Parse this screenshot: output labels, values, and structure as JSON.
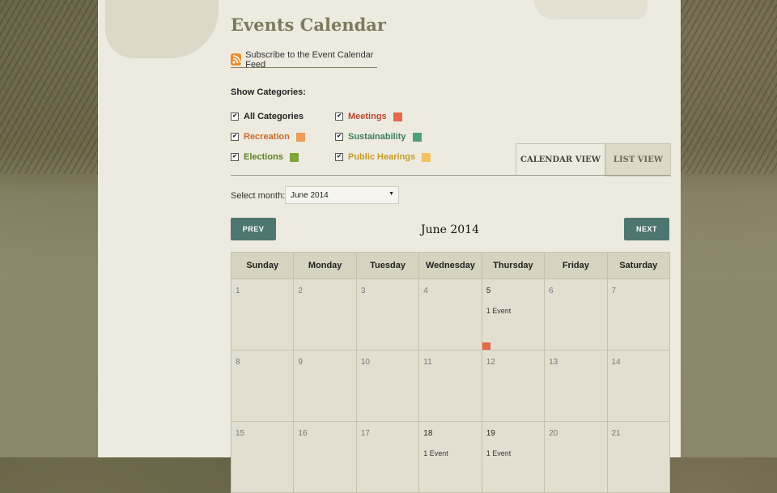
{
  "page": {
    "title": "Events Calendar"
  },
  "feed": {
    "label": "Subscribe to the Event Calendar Feed",
    "icon": "rss-icon"
  },
  "categories": {
    "heading": "Show Categories:",
    "items": [
      {
        "label": "All Categories",
        "color": "",
        "text_color": "#222222",
        "checked": true
      },
      {
        "label": "Meetings",
        "color": "#e5684b",
        "text_color": "#b9482f",
        "checked": true
      },
      {
        "label": "Recreation",
        "color": "#ef9a56",
        "text_color": "#c96a2b",
        "checked": true
      },
      {
        "label": "Sustainability",
        "color": "#4fa07c",
        "text_color": "#3b7d5c",
        "checked": true
      },
      {
        "label": "Elections",
        "color": "#7ea53b",
        "text_color": "#5e7f27",
        "checked": true
      },
      {
        "label": "Public Hearings",
        "color": "#f2c160",
        "text_color": "#c59a2b",
        "checked": true
      }
    ]
  },
  "views": {
    "calendar": "CALENDAR VIEW",
    "list": "LIST VIEW",
    "active": "calendar"
  },
  "month_select": {
    "label": "Select month:",
    "value": "June 2014"
  },
  "nav": {
    "prev": "PREV",
    "next": "NEXT"
  },
  "calendar": {
    "title": "June 2014",
    "days": [
      "Sunday",
      "Monday",
      "Tuesday",
      "Wednesday",
      "Thursday",
      "Friday",
      "Saturday"
    ],
    "weeks": [
      [
        {
          "d": "1"
        },
        {
          "d": "2"
        },
        {
          "d": "3"
        },
        {
          "d": "4"
        },
        {
          "d": "5",
          "events": "1 Event",
          "marker": "#e5684b"
        },
        {
          "d": "6"
        },
        {
          "d": "7"
        }
      ],
      [
        {
          "d": "8"
        },
        {
          "d": "9"
        },
        {
          "d": "10"
        },
        {
          "d": "11"
        },
        {
          "d": "12"
        },
        {
          "d": "13"
        },
        {
          "d": "14"
        }
      ],
      [
        {
          "d": "15"
        },
        {
          "d": "16"
        },
        {
          "d": "17"
        },
        {
          "d": "18",
          "events": "1 Event"
        },
        {
          "d": "19",
          "events": "1 Event"
        },
        {
          "d": "20"
        },
        {
          "d": "21"
        }
      ]
    ]
  }
}
